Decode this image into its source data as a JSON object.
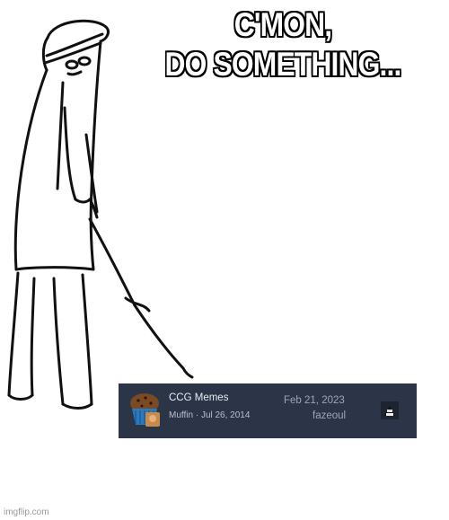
{
  "meme": {
    "caption_lines": [
      "C'MON,",
      "DO SOMETHING..."
    ]
  },
  "forum_thread": {
    "title": "CCG Memes",
    "author_line": "Muffin · Jul 26, 2014",
    "last_post_date": "Feb 21, 2023",
    "last_post_user": "fazeoul",
    "background_color": "#2b3547"
  },
  "watermark": "imgflip.com"
}
